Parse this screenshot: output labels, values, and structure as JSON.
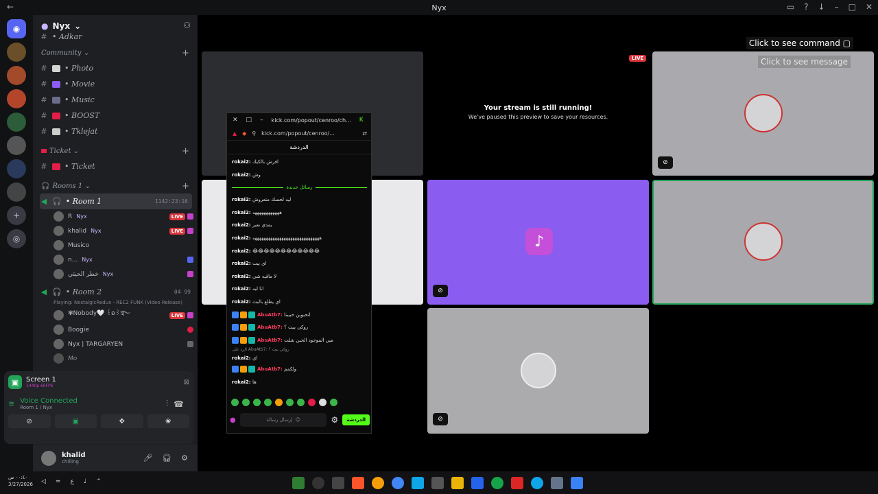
{
  "window": {
    "title": "Nyx"
  },
  "server": {
    "name": "Nyx"
  },
  "channels": {
    "top": {
      "label": "• Adkar"
    },
    "community": {
      "label": "Community",
      "items": [
        {
          "label": "• Photo",
          "color": "#d4d4d4"
        },
        {
          "label": "• Movie",
          "color": "#8b5cf6"
        },
        {
          "label": "• Music",
          "color": "#6b6b8a"
        },
        {
          "label": "• BOOST",
          "color": "#e11d48"
        },
        {
          "label": "• Tklejat",
          "color": "#cccccc"
        }
      ]
    },
    "ticket": {
      "label": "Ticket",
      "items": [
        {
          "label": "• Ticket",
          "color": "#e11d48"
        }
      ]
    },
    "rooms": {
      "label": "Rooms 1",
      "room1": {
        "label": "• Room 1",
        "timer": "1142:23:16"
      },
      "room1_users": [
        {
          "name": "R",
          "tag": "Nyx",
          "live": "LIVE"
        },
        {
          "name": "khalid",
          "tag": "Nyx",
          "live": "LIVE"
        },
        {
          "name": "Musico",
          "tag": "",
          "live": ""
        },
        {
          "name": "n...",
          "tag": "Nyx",
          "live": ""
        },
        {
          "name": "خطر الحيثي",
          "tag": "Nyx",
          "live": ""
        }
      ],
      "room2": {
        "label": "• Room 2",
        "count_a": "04",
        "count_b": "99",
        "playing": "Playing: NostalgicRedux - REC2 FUNK (Video Release)"
      },
      "room2_users": [
        {
          "name": "✾Nobody🤍 ꒰ʚ꒱࿐",
          "live": "LIVE"
        },
        {
          "name": "Boogie",
          "live": ""
        },
        {
          "name": "Nyx | TARGARYEN",
          "live": ""
        },
        {
          "name": "Mo",
          "live": ""
        }
      ]
    }
  },
  "screen_panel": {
    "title": "Screen 1",
    "sub": "1440p 60FPS"
  },
  "voice": {
    "status": "Voice Connected",
    "location": "Room 1 / Nyx"
  },
  "user": {
    "name": "khalid",
    "status": "chilling"
  },
  "stage": {
    "live": "LIVE",
    "running_title": "Your stream is still running!",
    "running_sub": "We've paused this preview to save your resources.",
    "cmd_tip": "Click to see command",
    "msg_tip": "Click to see message"
  },
  "popup": {
    "title_url": "kick.com/popout/cenroo/ch...",
    "address": "kick.com/popout/cenroo/...",
    "header": "الدردشة",
    "separator": "رسائل جديدة",
    "messages_before": [
      {
        "user": "rokai2:",
        "text": "افرش بالكيك"
      },
      {
        "user": "rokai2:",
        "text": "وش"
      }
    ],
    "messages_after": [
      {
        "user": "rokai2:",
        "text": "ليه لحسك متعروش"
      },
      {
        "user": "rokai2:",
        "text": "ههههههههههههه"
      },
      {
        "user": "rokai2:",
        "text": "يمدي نعبر"
      },
      {
        "user": "rokai2:",
        "text": "ههههههههههههههههههههههههههههههه"
      },
      {
        "user": "rokai2:",
        "text": "😂😂😂😂😂😂😂😂😂😂😂😂"
      },
      {
        "user": "rokai2:",
        "text": "اي بيت"
      },
      {
        "user": "rokai2:",
        "text": "لا ماقيه شي"
      },
      {
        "user": "rokai2:",
        "text": "انا ليه"
      },
      {
        "user": "rokai2:",
        "text": "اي يطلع بالبث"
      }
    ],
    "badge_messages": [
      {
        "user": "AbuAtb7:",
        "text": "اتحبوين حبيبنا"
      },
      {
        "user": "AbuAtb7:",
        "text": "روكي بيت ؟"
      },
      {
        "user": "AbuAtb7:",
        "text": "مين الموجود الحين شلت"
      }
    ],
    "reply": "الرد على AbuAtb7: روكي بيت ؟",
    "reply_msg": {
      "user": "rokai2:",
      "text": "اي"
    },
    "after_reply": [
      {
        "user": "AbuAtb7:",
        "text": "ولكمم"
      }
    ],
    "last": {
      "user": "rokai2:",
      "text": "ها"
    },
    "input_placeholder": "إرسال رسالة",
    "send": "الدردشة"
  },
  "taskbar": {
    "time": "٠٠:٤٠ ص",
    "date": "3/27/2026",
    "lang": "ع"
  }
}
